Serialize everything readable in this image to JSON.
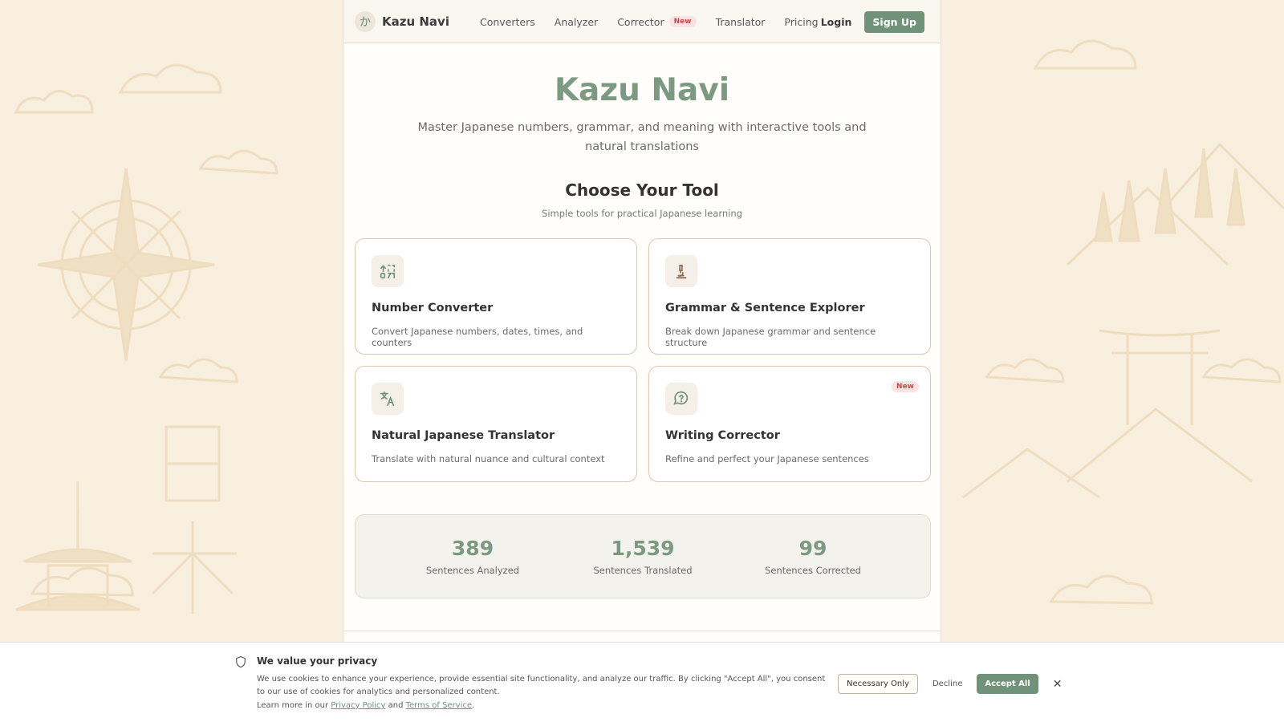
{
  "nav": {
    "logo_mark": "か",
    "brand": "Kazu Navi",
    "links": [
      {
        "label": "Converters"
      },
      {
        "label": "Analyzer"
      },
      {
        "label": "Corrector",
        "badge": "New"
      },
      {
        "label": "Translator"
      },
      {
        "label": "Pricing"
      }
    ],
    "login": "Login",
    "signup": "Sign Up"
  },
  "hero": {
    "title": "Kazu Navi",
    "subtitle": "Master Japanese numbers, grammar, and meaning with interactive tools and natural translations"
  },
  "tools": {
    "title": "Choose Your Tool",
    "subtitle": "Simple tools for practical Japanese learning",
    "cards": [
      {
        "title": "Number Converter",
        "desc": "Convert Japanese numbers, dates, times, and counters",
        "icon": "number-convert-icon"
      },
      {
        "title": "Grammar & Sentence Explorer",
        "desc": "Break down Japanese grammar and sentence structure",
        "icon": "microscope-icon"
      },
      {
        "title": "Natural Japanese Translator",
        "desc": "Translate with natural nuance and cultural context",
        "icon": "translate-icon"
      },
      {
        "title": "Writing Corrector",
        "desc": "Refine and perfect your Japanese sentences",
        "icon": "message-question-icon",
        "badge": "New"
      }
    ]
  },
  "stats": [
    {
      "value": "389",
      "label": "Sentences Analyzed"
    },
    {
      "value": "1,539",
      "label": "Sentences Translated"
    },
    {
      "value": "99",
      "label": "Sentences Corrected"
    }
  ],
  "cookie": {
    "title": "We value your privacy",
    "text": "We use cookies to enhance your experience, provide essential site functionality, and analyze our traffic. By clicking \"Accept All\", you consent to our use of cookies for analytics and personalized content.",
    "more_prefix": "Learn more in our",
    "privacy_link": "Privacy Policy",
    "and": "and",
    "terms_link": "Terms of Service",
    "period": ".",
    "necessary": "Necessary Only",
    "decline": "Decline",
    "accept": "Accept All",
    "close": "✕"
  },
  "colors": {
    "accent": "#6f9278",
    "title_green": "#7c9a81",
    "background": "#f8efde",
    "badge_red": "#c44a4a"
  }
}
